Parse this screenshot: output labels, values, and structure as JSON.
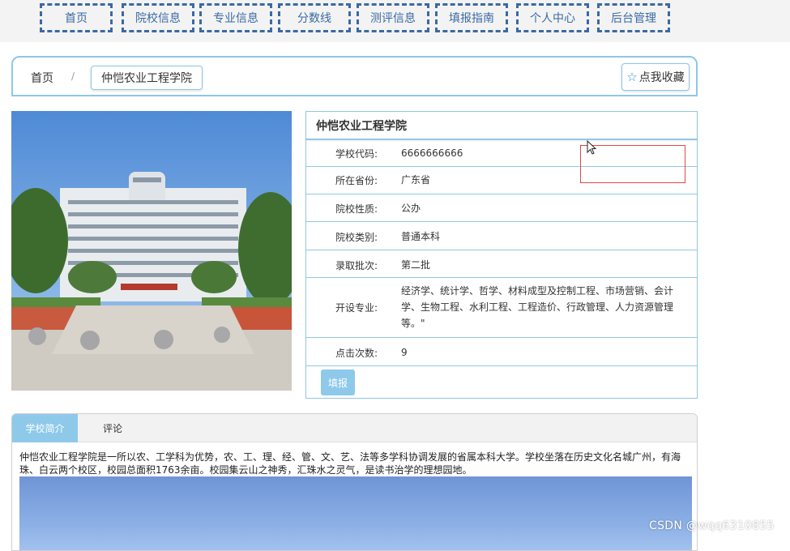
{
  "nav": {
    "items": [
      {
        "label": "首页"
      },
      {
        "label": "院校信息"
      },
      {
        "label": "专业信息"
      },
      {
        "label": "分数线"
      },
      {
        "label": "测评信息"
      },
      {
        "label": "填报指南"
      },
      {
        "label": "个人中心"
      },
      {
        "label": "后台管理"
      }
    ]
  },
  "breadcrumb": {
    "home": "首页",
    "separator": "/",
    "current": "仲恺农业工程学院"
  },
  "favorite": {
    "icon": "star-icon",
    "label": "点我收藏"
  },
  "school": {
    "name": "仲恺农业工程学院",
    "fields": [
      {
        "key": "学校代码:",
        "value": "6666666666"
      },
      {
        "key": "所在省份:",
        "value": "广东省"
      },
      {
        "key": "院校性质:",
        "value": "公办"
      },
      {
        "key": "院校类别:",
        "value": "普通本科"
      },
      {
        "key": "录取批次:",
        "value": "第二批"
      },
      {
        "key": "开设专业:",
        "value": "经济学、统计学、哲学、材料成型及控制工程、市场营销、会计学、生物工程、水利工程、工程造价、行政管理、人力资源管理等。\""
      },
      {
        "key": "点击次数:",
        "value": "9"
      }
    ],
    "apply_label": "填报"
  },
  "tabs": {
    "items": [
      {
        "label": "学校简介"
      },
      {
        "label": "评论"
      }
    ],
    "intro_text": "仲恺农业工程学院是一所以农、工学科为优势，农、工、理、经、管、文、艺、法等多学科协调发展的省属本科大学。学校坐落在历史文化名城广州，有海珠、白云两个校区，校园总面积1763余亩。校园集云山之神秀，汇珠水之灵气，是读书治学的理想园地。"
  },
  "watermark": "CSDN @wqq6310855",
  "colors": {
    "accent": "#3a6aa3",
    "border": "#8fc7e6",
    "button": "#8ec9ea",
    "annotation": "#e04848"
  }
}
